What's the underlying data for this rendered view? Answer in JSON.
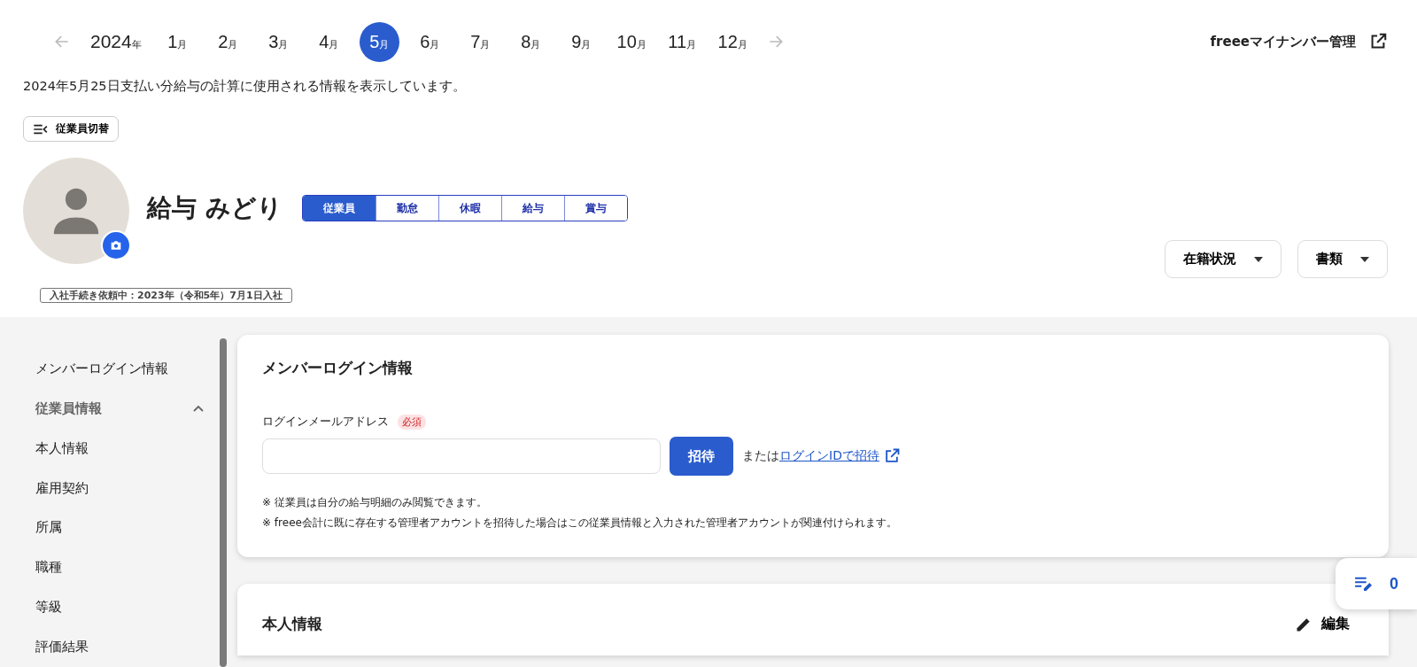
{
  "year_nav": {
    "year": "2024",
    "year_unit": "年",
    "months": [
      {
        "num": "1",
        "unit": "月",
        "selected": false
      },
      {
        "num": "2",
        "unit": "月",
        "selected": false
      },
      {
        "num": "3",
        "unit": "月",
        "selected": false
      },
      {
        "num": "4",
        "unit": "月",
        "selected": false
      },
      {
        "num": "5",
        "unit": "月",
        "selected": true
      },
      {
        "num": "6",
        "unit": "月",
        "selected": false
      },
      {
        "num": "7",
        "unit": "月",
        "selected": false
      },
      {
        "num": "8",
        "unit": "月",
        "selected": false
      },
      {
        "num": "9",
        "unit": "月",
        "selected": false
      },
      {
        "num": "10",
        "unit": "月",
        "selected": false
      },
      {
        "num": "11",
        "unit": "月",
        "selected": false
      },
      {
        "num": "12",
        "unit": "月",
        "selected": false
      }
    ]
  },
  "external_link": "freeeマイナンバー管理",
  "description": "2024年5月25日支払い分給与の計算に使用される情報を表示しています。",
  "switch_button": "従業員切替",
  "employee": {
    "name": "給与 みどり",
    "status": "入社手続き依頼中：2023年（令和5年）7月1日入社"
  },
  "tabs": [
    {
      "label": "従業員",
      "selected": true
    },
    {
      "label": "勤怠",
      "selected": false
    },
    {
      "label": "休暇",
      "selected": false
    },
    {
      "label": "給与",
      "selected": false
    },
    {
      "label": "賞与",
      "selected": false
    }
  ],
  "actions": [
    "在籍状況",
    "書類"
  ],
  "sidebar": {
    "items": [
      {
        "label": "メンバーログイン情報"
      },
      {
        "label": "従業員情報",
        "expanded": true,
        "children": [
          {
            "label": "本人情報"
          },
          {
            "label": "雇用契約"
          },
          {
            "label": "所属"
          },
          {
            "label": "職種"
          },
          {
            "label": "等級"
          },
          {
            "label": "評価結果"
          }
        ]
      }
    ]
  },
  "login_card": {
    "title": "メンバーログイン情報",
    "field_label": "ログインメールアドレス",
    "required_badge": "必須",
    "invite_button": "招待",
    "or_text": "または",
    "login_id_link": "ログインIDで招待",
    "notes": [
      "※ 従業員は自分の給与明細のみ閲覧できます。",
      "※ freee会計に既に存在する管理者アカウントを招待した場合はこの従業員情報と入力された管理者アカウントが関連付けられます。"
    ]
  },
  "personal_card": {
    "title": "本人情報",
    "edit_button": "編集"
  },
  "floating_counter": "0"
}
